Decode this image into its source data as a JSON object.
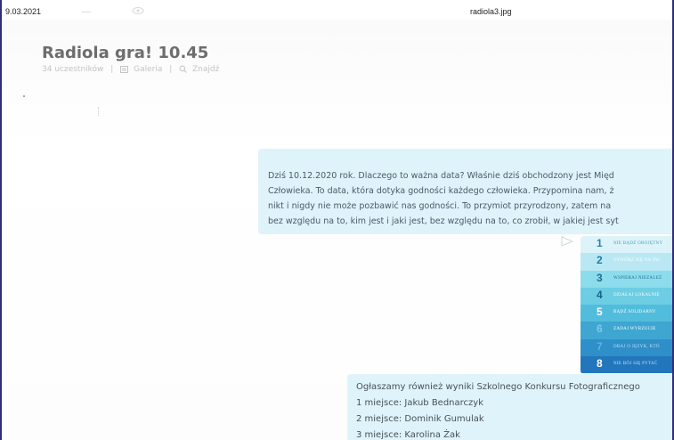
{
  "viewer": {
    "date": "9.03.2021",
    "filename": "radiola3.jpg"
  },
  "chat": {
    "title": "Radiola gra! 10.45",
    "participants": "34 uczestników",
    "gallery": "Galeria",
    "find": "Znajdź",
    "separator": "|"
  },
  "message1": {
    "lines": [
      "Dziś 10.12.2020 rok. Dlaczego to ważna data? Właśnie dziś obchodzony jest Międ",
      "Człowieka. To data, która dotyka godności każdego człowieka. Przypomina nam, ż",
      "nikt i nigdy nie może pozbawić nas godności. To przymiot przyrodzony, zatem na",
      "bez względu na to, kim jest i jaki jest, bez względu na to, co zrobił, w jakiej jest syt"
    ]
  },
  "steps_graphic": {
    "items": [
      {
        "num": "1",
        "text": "NIE BĄDŹ OBOJĘTNY",
        "bg": "#ddf3fa",
        "numColor": "#2e7fa6",
        "textColor": "#4a9bbd"
      },
      {
        "num": "2",
        "text": "OTWÓRZ SIĘ NA ŚW",
        "bg": "#b9e8f4",
        "numColor": "#1e7ea8",
        "textColor": "#ffffff"
      },
      {
        "num": "3",
        "text": "WSPIERAJ NIEZALEŻ",
        "bg": "#8ddcec",
        "numColor": "#1a6f96",
        "textColor": "#1a6f96"
      },
      {
        "num": "4",
        "text": "DZIAŁAJ LOKALNIE",
        "bg": "#6ccde3",
        "numColor": "#16648a",
        "textColor": "#ffffff"
      },
      {
        "num": "5",
        "text": "BĄDŹ SOLIDARNY",
        "bg": "#52bcdc",
        "numColor": "#ffffff",
        "textColor": "#ffffff"
      },
      {
        "num": "6",
        "text": "ZADAJ WYRZUCIE",
        "bg": "#3fa6d2",
        "numColor": "#7ecbe6",
        "textColor": "#ffffff"
      },
      {
        "num": "7",
        "text": "DBAJ O JĘZYK, KTÓ",
        "bg": "#2f8fc8",
        "numColor": "#5ab3df",
        "textColor": "#bfe3f3"
      },
      {
        "num": "8",
        "text": "NIE BÓJ SIĘ PYTAĆ",
        "bg": "#2276bb",
        "numColor": "#ffffff",
        "textColor": "#bfe3f3"
      }
    ]
  },
  "message2": {
    "lines": [
      "Ogłaszamy również wyniki Szkolnego Konkursu Fotograficznego",
      "1 miejsce: Jakub Bednarczyk",
      "2 miejsce: Dominik Gumulak",
      "3 miejsce: Karolina Żak"
    ]
  },
  "icons": {
    "gallery": "gallery-icon",
    "search": "search-icon",
    "send": "send-arrow-icon",
    "eye": "eye-icon"
  }
}
